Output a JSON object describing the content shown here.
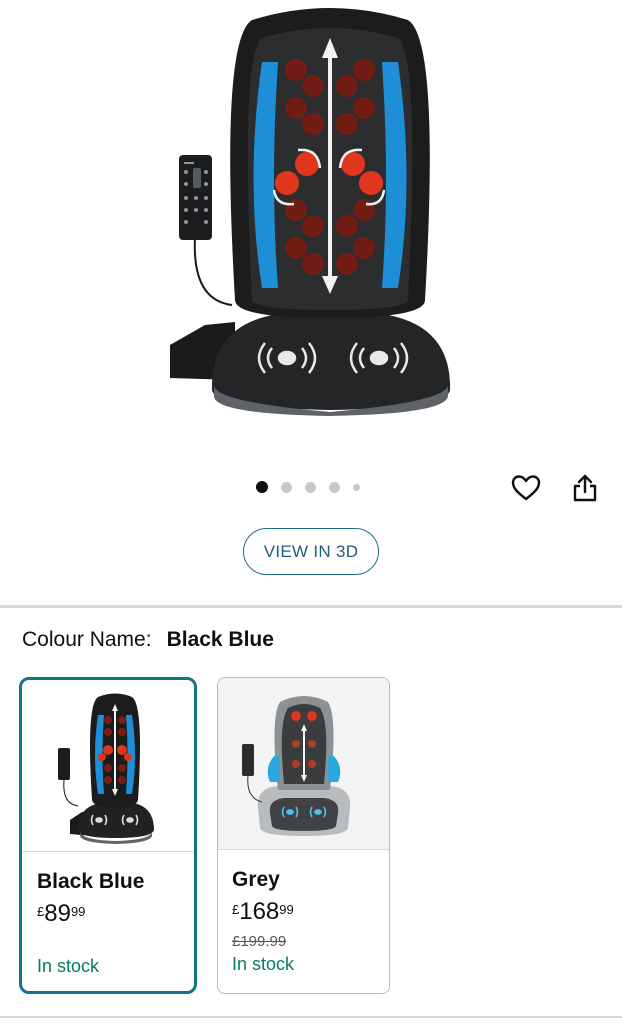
{
  "product": {
    "image_alt": "Massage seat cushion with remote, black and blue",
    "carousel": {
      "total": 5,
      "active_index": 0
    },
    "actions": {
      "favourite_icon": "heart-outline-icon",
      "share_icon": "share-icon"
    },
    "view_3d_label": "VIEW IN 3D"
  },
  "colour": {
    "label": "Colour Name:",
    "selected": "Black Blue"
  },
  "variants": [
    {
      "name": "Black Blue",
      "price_symbol": "£",
      "price_whole": "89",
      "price_fraction": "99",
      "was_price": "",
      "stock": "In stock",
      "selected": true
    },
    {
      "name": "Grey",
      "price_symbol": "£",
      "price_whole": "168",
      "price_fraction": "99",
      "was_price": "£199.99",
      "stock": "In stock",
      "selected": false
    }
  ],
  "colors": {
    "accent": "#137587",
    "stock_green": "#067d62",
    "button_blue": "#1e5f7a"
  }
}
